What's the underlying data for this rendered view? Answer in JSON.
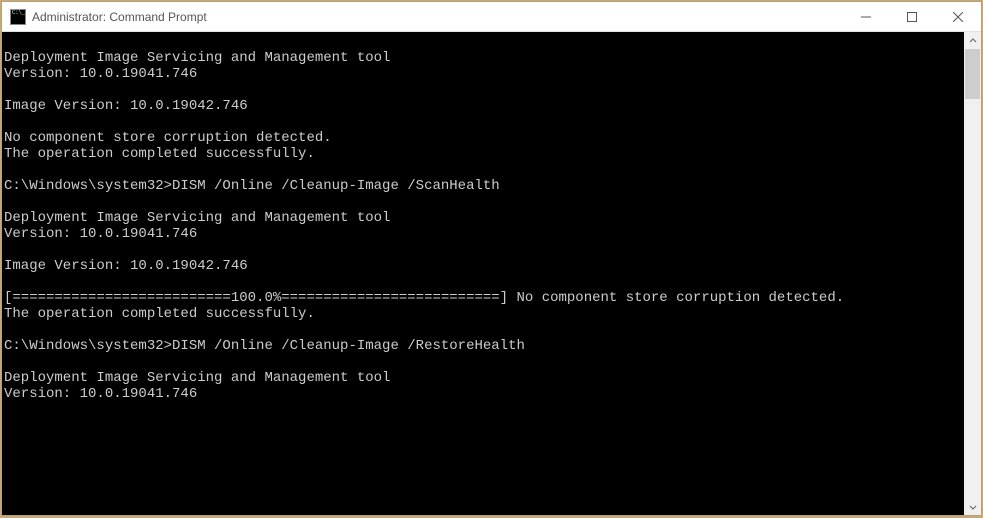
{
  "window": {
    "title": "Administrator: Command Prompt"
  },
  "lines": {
    "l0": "",
    "l1": "Deployment Image Servicing and Management tool",
    "l2": "Version: 10.0.19041.746",
    "l3": "",
    "l4": "Image Version: 10.0.19042.746",
    "l5": "",
    "l6": "No component store corruption detected.",
    "l7": "The operation completed successfully.",
    "l8": "",
    "l9": "C:\\Windows\\system32>DISM /Online /Cleanup-Image /ScanHealth",
    "l10": "",
    "l11": "Deployment Image Servicing and Management tool",
    "l12": "Version: 10.0.19041.746",
    "l13": "",
    "l14": "Image Version: 10.0.19042.746",
    "l15": "",
    "l16": "[==========================100.0%==========================] No component store corruption detected.",
    "l17": "The operation completed successfully.",
    "l18": "",
    "l19": "C:\\Windows\\system32>DISM /Online /Cleanup-Image /RestoreHealth",
    "l20": "",
    "l21": "Deployment Image Servicing and Management tool",
    "l22": "Version: 10.0.19041.746"
  }
}
